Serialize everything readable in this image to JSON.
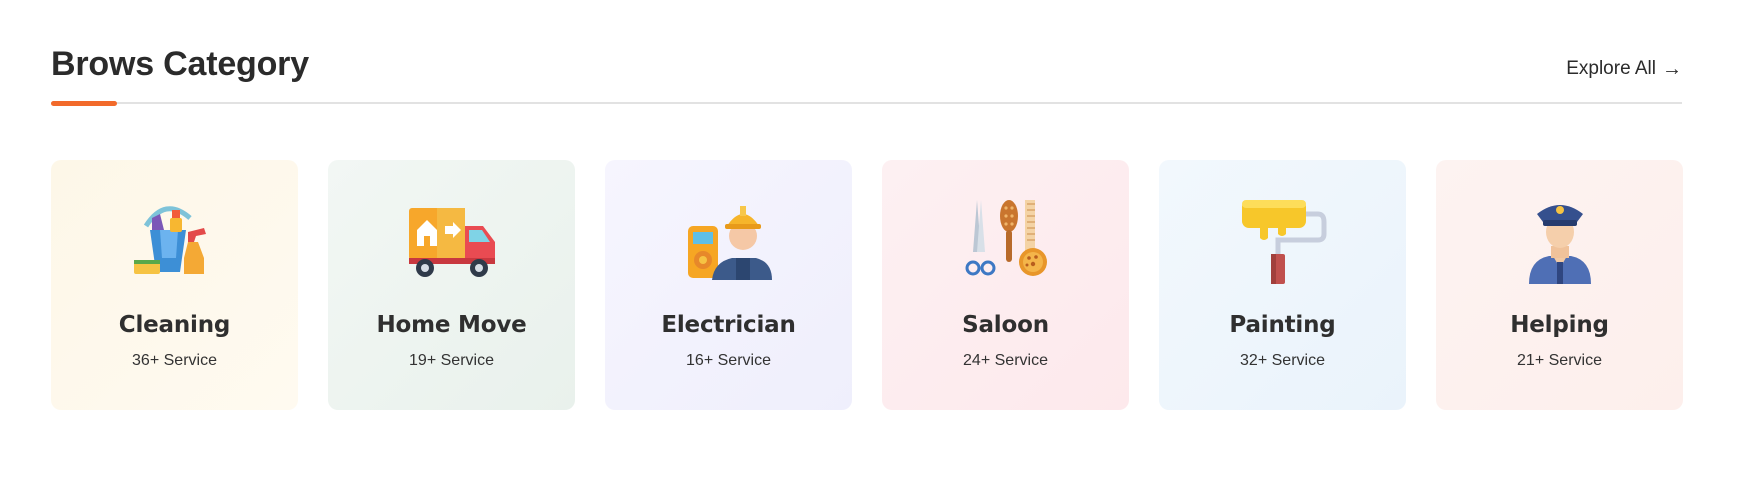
{
  "header": {
    "title": "Brows Category",
    "explore_label": "Explore All",
    "explore_arrow": "→",
    "accent": "#f26a2b"
  },
  "categories": [
    {
      "name": "Cleaning",
      "count": "36+ Service",
      "icon": "cleaning-bucket-icon",
      "bg": "#fdf8ec"
    },
    {
      "name": "Home Move",
      "count": "19+ Service",
      "icon": "moving-truck-icon",
      "bg": "#eef4f1"
    },
    {
      "name": "Electrician",
      "count": "16+ Service",
      "icon": "electrician-icon",
      "bg": "#f3f2fd"
    },
    {
      "name": "Saloon",
      "count": "24+ Service",
      "icon": "salon-tools-icon",
      "bg": "#fdeef1"
    },
    {
      "name": "Painting",
      "count": "32+ Service",
      "icon": "paint-roller-icon",
      "bg": "#eef6fc"
    },
    {
      "name": "Helping",
      "count": "21+ Service",
      "icon": "helper-icon",
      "bg": "#fdf1ef"
    }
  ]
}
